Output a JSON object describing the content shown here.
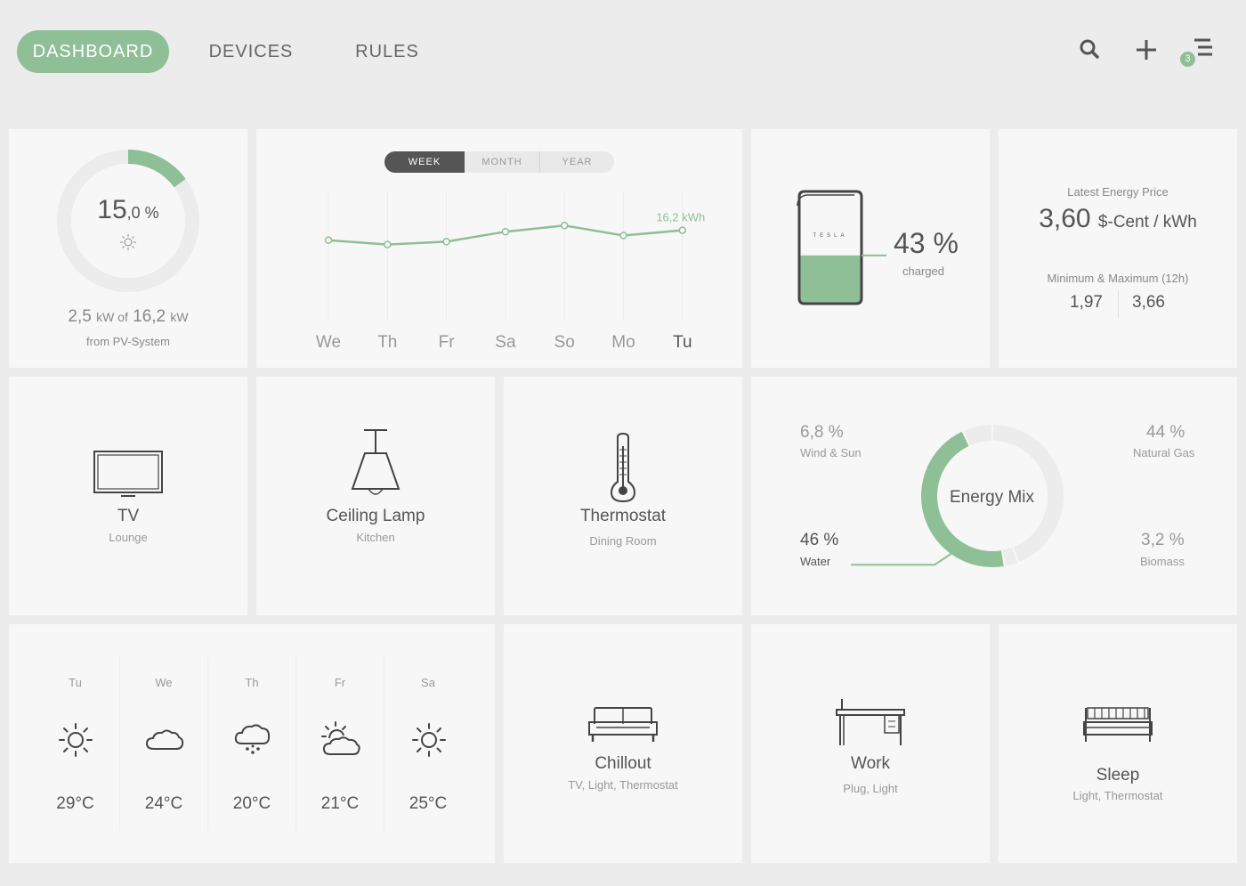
{
  "nav": {
    "tabs": [
      {
        "label": "DASHBOARD",
        "active": true
      },
      {
        "label": "DEVICES",
        "active": false
      },
      {
        "label": "RULES",
        "active": false
      }
    ],
    "icons": [
      "search-icon",
      "plus-icon",
      "menu-icon"
    ],
    "notification_count": "3"
  },
  "colors": {
    "accent": "#8fbf96",
    "background": "#ececec",
    "card": "#f7f7f7",
    "text": "#555555",
    "muted": "#999999"
  },
  "pv": {
    "percent_main": "15",
    "percent_dec": ",0 %",
    "progress": 0.15,
    "kw_current": "2,5",
    "kw_unit_1": "kW of",
    "kw_total": "16,2",
    "kw_unit_2": "kW",
    "source": "from PV-System",
    "icon": "sun-icon"
  },
  "chart": {
    "range_tabs": [
      "WEEK",
      "MONTH",
      "YEAR"
    ],
    "active_range": "WEEK",
    "chart_data": {
      "type": "line",
      "categories": [
        "We",
        "Th",
        "Fr",
        "Sa",
        "So",
        "Mo",
        "Tu"
      ],
      "values": [
        14.1,
        13.2,
        13.8,
        15.9,
        17.2,
        15.1,
        16.2
      ],
      "annotation": "16,2 kWh",
      "ylim": [
        0,
        30
      ],
      "grid": "vertical"
    }
  },
  "battery": {
    "brand": "TESLA",
    "percent": "43 %",
    "level": 0.43,
    "label": "charged"
  },
  "price": {
    "heading": "Latest Energy Price",
    "value": "3,60",
    "unit": "$-Cent / kWh",
    "range_heading": "Minimum & Maximum (12h)",
    "min": "1,97",
    "max": "3,66"
  },
  "devices": [
    {
      "name": "TV",
      "room": "Lounge",
      "icon": "tv-icon"
    },
    {
      "name": "Ceiling Lamp",
      "room": "Kitchen",
      "icon": "lamp-icon"
    },
    {
      "name": "Thermostat",
      "room": "Dining Room",
      "icon": "thermometer-icon"
    }
  ],
  "energy_mix": {
    "title": "Energy Mix",
    "chart_data": {
      "type": "pie",
      "slices": [
        {
          "label": "Natural Gas",
          "value": 44,
          "display": "44 %"
        },
        {
          "label": "Biomass",
          "value": 3.2,
          "display": "3,2 %"
        },
        {
          "label": "Water",
          "value": 46,
          "display": "46 %"
        },
        {
          "label": "Wind & Sun",
          "value": 6.8,
          "display": "6,8 %"
        }
      ],
      "highlighted": "Water"
    }
  },
  "weather": [
    {
      "day": "Tu",
      "temp": "29°C",
      "icon": "sun-icon"
    },
    {
      "day": "We",
      "temp": "24°C",
      "icon": "cloud-icon"
    },
    {
      "day": "Th",
      "temp": "20°C",
      "icon": "rain-cloud-icon"
    },
    {
      "day": "Fr",
      "temp": "21°C",
      "icon": "sun-cloud-icon"
    },
    {
      "day": "Sa",
      "temp": "25°C",
      "icon": "sun-icon"
    }
  ],
  "scenes": [
    {
      "name": "Chillout",
      "devices": "TV, Light, Thermostat",
      "icon": "sofa-icon"
    },
    {
      "name": "Work",
      "devices": "Plug, Light",
      "icon": "desk-icon"
    },
    {
      "name": "Sleep",
      "devices": "Light, Thermostat",
      "icon": "bed-icon"
    }
  ]
}
